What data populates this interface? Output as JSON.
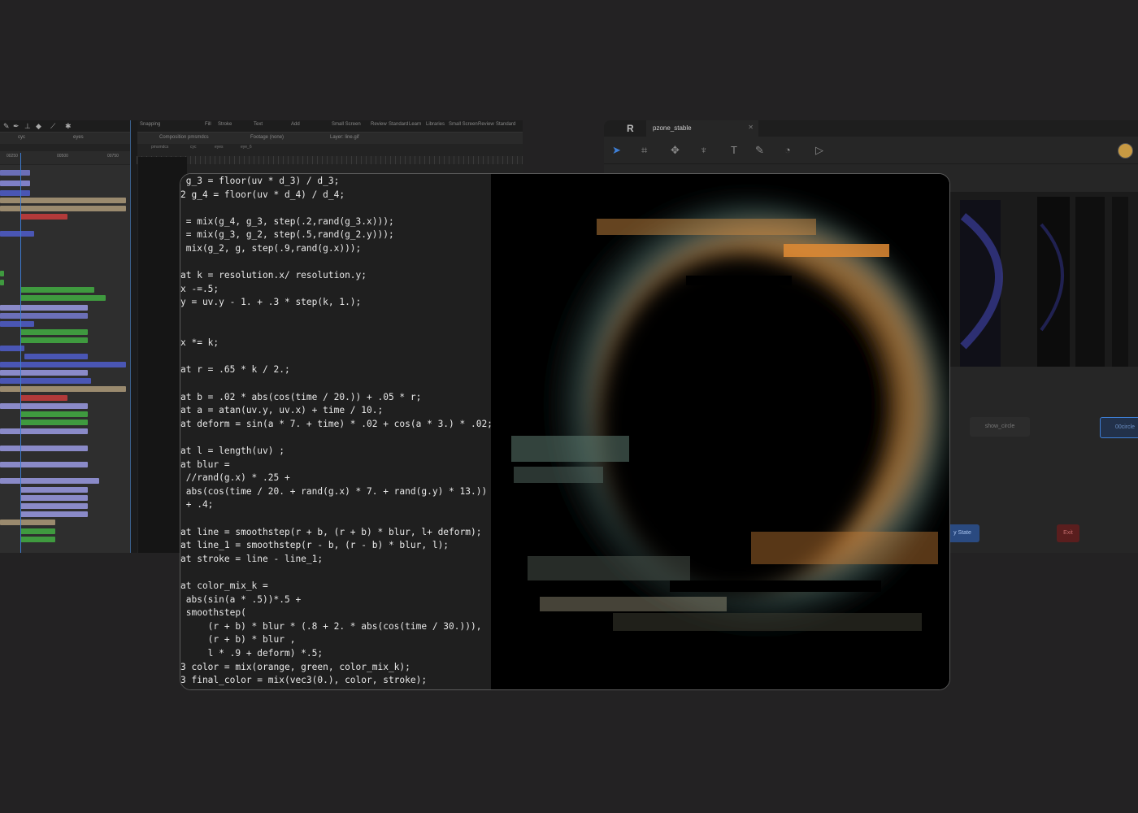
{
  "timeline": {
    "tabs": [
      "cyc",
      "eyes"
    ],
    "comp_tab": "Composition pmsmdcs",
    "footage_tab": "Footage (none)",
    "layer_tab": "Layer: line.gif",
    "sub_tabs": [
      "pmsmdcs",
      "cyc",
      "eyes",
      "eye_6"
    ],
    "ruler": [
      "00250",
      "00500",
      "00750"
    ],
    "menu": [
      "Snapping",
      "Fill",
      "Stroke",
      "Text",
      "Add",
      "Small Screen",
      "Review",
      "Standard",
      "Learn",
      "Libraries",
      "Small Screen",
      "Review",
      "Standard"
    ]
  },
  "editor": {
    "tab_title": "pzone_stable",
    "logo": "R",
    "nodes": [
      {
        "label": "show_circle"
      },
      {
        "label": "00circle"
      }
    ],
    "buttons": {
      "state": "y State",
      "exit": "Exit"
    }
  },
  "code": {
    "lines": [
      " g_3 = floor(uv * d_3) / d_3;",
      "2 g_4 = floor(uv * d_4) / d_4;",
      "",
      " = mix(g_4, g_3, step(.2,rand(g_3.x)));",
      " = mix(g_3, g_2, step(.5,rand(g_2.y)));",
      " mix(g_2, g, step(.9,rand(g.x)));",
      "",
      "at k = resolution.x/ resolution.y;",
      "x -=.5;",
      "y = uv.y - 1. + .3 * step(k, 1.);",
      "",
      "",
      "x *= k;",
      "",
      "at r = .65 * k / 2.;",
      "",
      "at b = .02 * abs(cos(time / 20.)) + .05 * r;",
      "at a = atan(uv.y, uv.x) + time / 10.;",
      "at deform = sin(a * 7. + time) * .02 + cos(a * 3.) * .02;",
      "",
      "at l = length(uv) ;",
      "at blur =",
      " //rand(g.x) * .25 +",
      " abs(cos(time / 20. + rand(g.x) * 7. + rand(g.y) * 13.))",
      " + .4;",
      "",
      "at line = smoothstep(r + b, (r + b) * blur, l+ deform);",
      "at line_1 = smoothstep(r - b, (r - b) * blur, l);",
      "at stroke = line - line_1;",
      "",
      "at color_mix_k =",
      " abs(sin(a * .5))*.5 +",
      " smoothstep(",
      "     (r + b) * blur * (.8 + 2. * abs(cos(time / 30.))),",
      "     (r + b) * blur ,",
      "     l * .9 + deform) *.5;",
      "3 color = mix(orange, green, color_mix_k);",
      "3 final_color = mix(vec3(0.), color, stroke);"
    ]
  },
  "colors": {
    "background": "#232223",
    "accent_blue": "#3e7fd6",
    "ring_orange": "#d98a3a",
    "ring_teal": "#6fa6a0"
  }
}
